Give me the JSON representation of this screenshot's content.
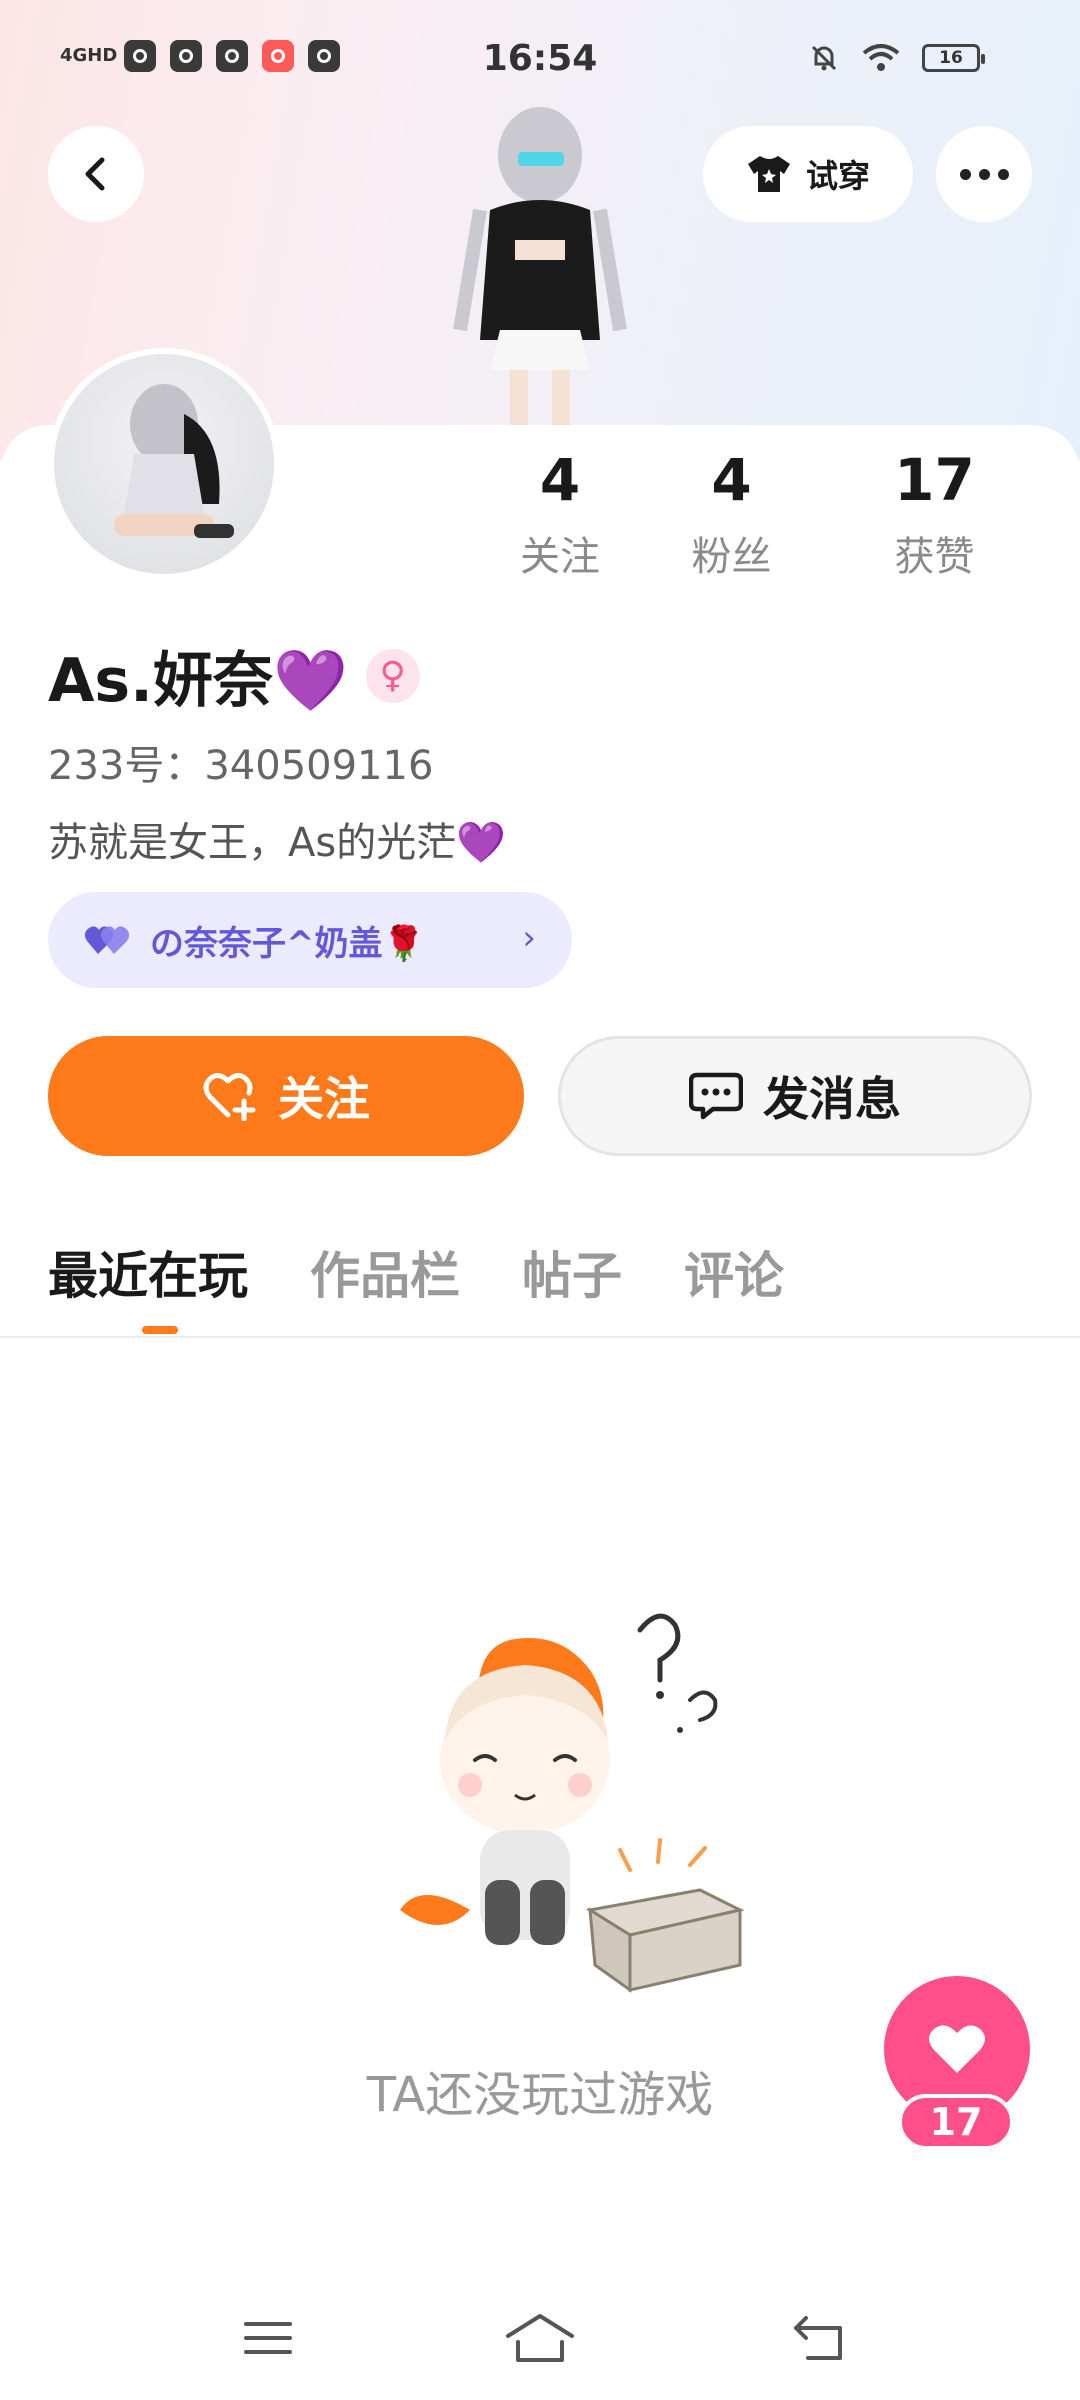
{
  "status_bar": {
    "time": "16:54",
    "network": "4GHD",
    "battery": "16"
  },
  "header": {
    "try_on_label": "试穿"
  },
  "stats": [
    {
      "value": "4",
      "label": "关注"
    },
    {
      "value": "4",
      "label": "粉丝"
    },
    {
      "value": "17",
      "label": "获赞"
    }
  ],
  "profile": {
    "name": "As.妍奈💜",
    "gender_symbol": "♀",
    "id_line": "233号：340509116",
    "bio": "苏就是女王，As的光茫💜",
    "fan_group": "の奈奈子^奶盖🌹"
  },
  "actions": {
    "follow_label": "关注",
    "message_label": "发消息"
  },
  "tabs": [
    {
      "label": "最近在玩",
      "active": true
    },
    {
      "label": "作品栏",
      "active": false
    },
    {
      "label": "帖子",
      "active": false
    },
    {
      "label": "评论",
      "active": false
    }
  ],
  "empty_state": {
    "text": "TA还没玩过游戏"
  },
  "like_fab": {
    "count": "17"
  },
  "colors": {
    "accent": "#ff7a1a",
    "like": "#ff4f8b",
    "fan_group": "#6358d8"
  }
}
